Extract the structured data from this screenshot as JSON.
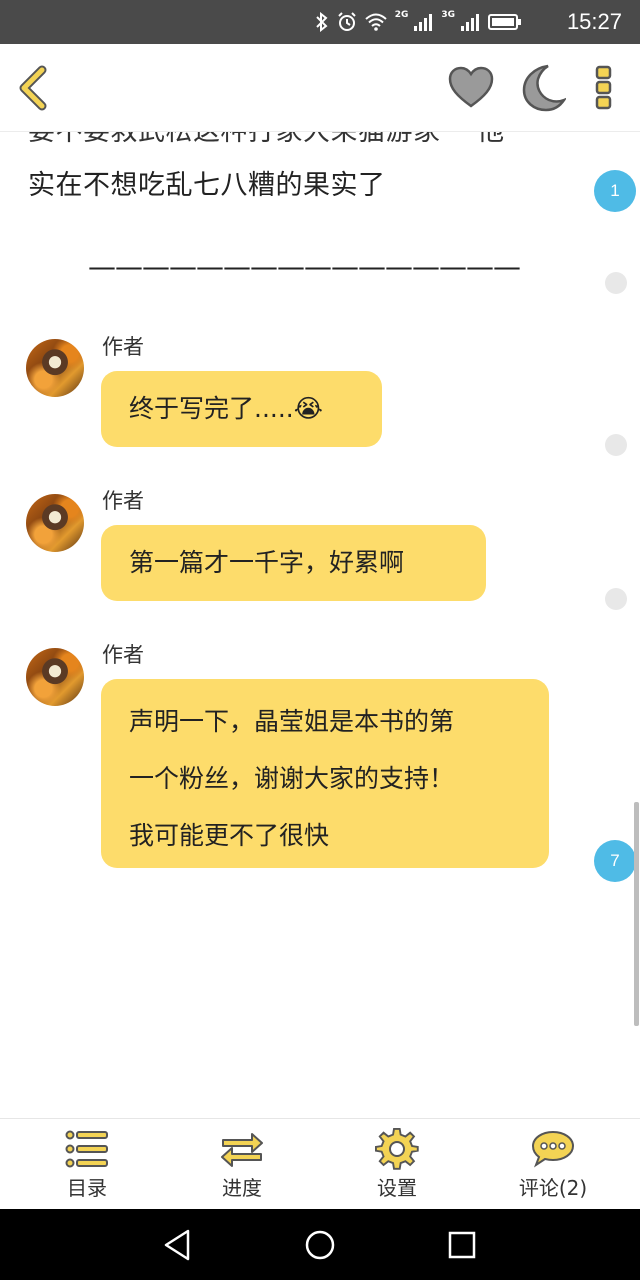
{
  "status_bar": {
    "network_1": "2G",
    "network_2": "3G",
    "time": "15:27"
  },
  "top_bar": {
    "icons": [
      "back-chevron-icon",
      "heart-icon",
      "moon-icon",
      "more-dots-icon"
    ],
    "accent_color": "#f3d354"
  },
  "content": {
    "cut_line": "要不要救武松这种打家大朵猫游家一  他",
    "paragraph": "实在不想吃乱七八糟的果实了",
    "separator": "————————————————",
    "comment_counts": [
      "1",
      "7"
    ],
    "author_notes": [
      {
        "name": "作者",
        "lines": [
          "终于写完了.....😭"
        ]
      },
      {
        "name": "作者",
        "lines": [
          "第一篇才一千字，好累啊"
        ]
      },
      {
        "name": "作者",
        "lines": [
          "声明一下，晶莹姐是本书的第",
          "一个粉丝，谢谢大家的支持！",
          "我可能更不了很快"
        ]
      }
    ],
    "bubble_color": "#fddc6b"
  },
  "bottom_bar": {
    "toc_label": "目录",
    "progress_label": "进度",
    "settings_label": "设置",
    "comments_label": "评论(2)"
  },
  "nav_bar": {
    "icons": [
      "back-triangle-icon",
      "home-circle-icon",
      "recents-square-icon"
    ]
  }
}
